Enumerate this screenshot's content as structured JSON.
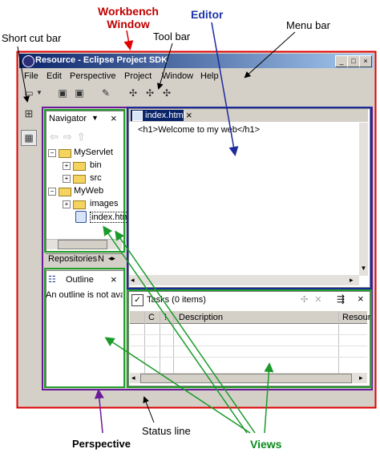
{
  "annotations": {
    "workbench_window": [
      "Workbench",
      "Window"
    ],
    "editor": "Editor",
    "shortcut_bar": "Short cut bar",
    "tool_bar": "Tool bar",
    "menu_bar": "Menu bar",
    "status_line": "Status line",
    "perspective": "Perspective",
    "views": "Views"
  },
  "window": {
    "title": "Resource - Eclipse Project SDK",
    "buttons": [
      "_",
      "□",
      "×"
    ]
  },
  "menu": [
    "File",
    "Edit",
    "Perspective",
    "Project",
    "Window",
    "Help"
  ],
  "navigator": {
    "title": "Navigator",
    "tree": [
      {
        "label": "MyServlet",
        "level": 0
      },
      {
        "label": "bin",
        "level": 1
      },
      {
        "label": "src",
        "level": 1
      },
      {
        "label": "MyWeb",
        "level": 0
      },
      {
        "label": "images",
        "level": 1
      },
      {
        "label": "index.htm",
        "level": 1
      }
    ],
    "bottom_tabs": [
      "Repositories",
      "N"
    ]
  },
  "outline": {
    "title": "Outline",
    "message": "An outline is not avai"
  },
  "editor_panel": {
    "tab": "index.html",
    "content": "<h1>Welcome to my web</h1>"
  },
  "tasks": {
    "title": "Tasks (0 items)",
    "columns": [
      "C",
      "!",
      "Description",
      "Resour"
    ]
  },
  "colors": {
    "workbench_border": "#e00000",
    "editor_border": "#1c2a9c",
    "view_border": "#22a02a",
    "perspective_border": "#6a1a9a",
    "arrow_green": "#1a9a2a"
  },
  "icons": [
    "eclipse-logo-icon",
    "new-icon",
    "dropdown-icon",
    "save-icon",
    "save-all-icon",
    "wand-icon",
    "run-icon",
    "search-icon",
    "open-perspective-icon",
    "resource-perspective-icon",
    "folder-icon",
    "file-icon",
    "outline-icon",
    "tasks-icon"
  ]
}
